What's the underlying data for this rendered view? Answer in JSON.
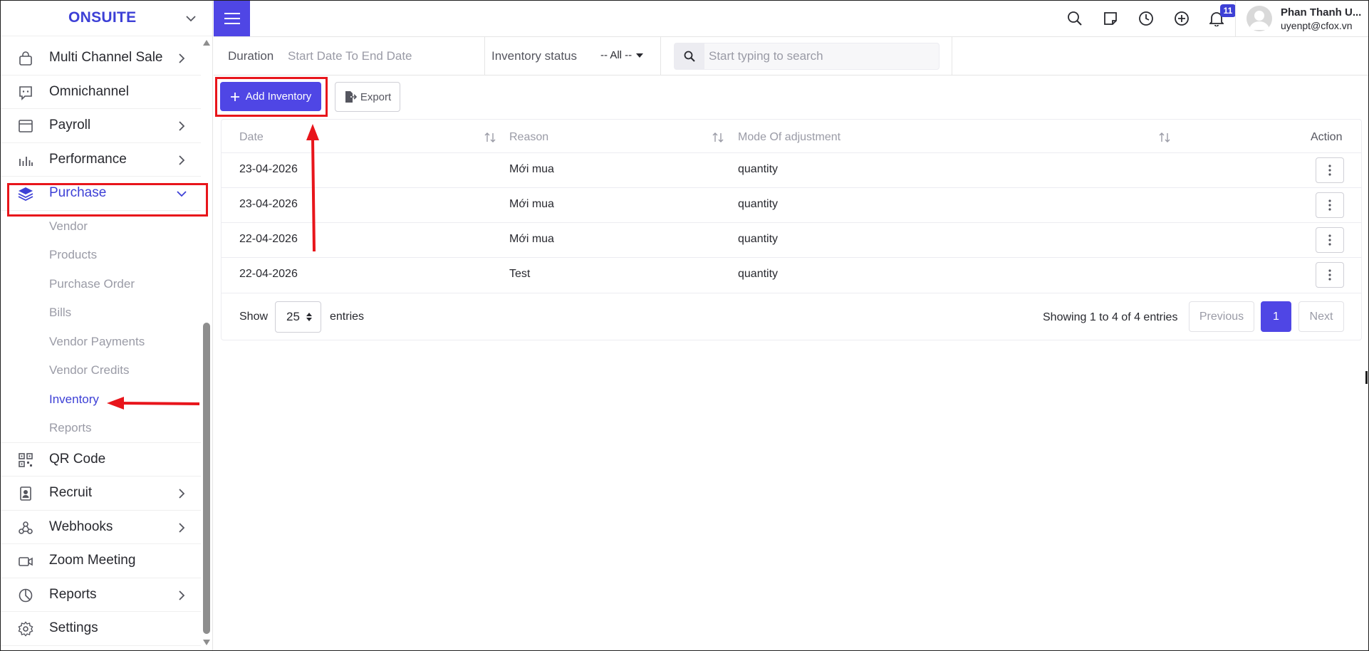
{
  "brand": {
    "name": "ONSUITE"
  },
  "sidebar": {
    "items": [
      {
        "label": "Multi Channel Sale",
        "icon": "shopping-bag-icon",
        "has_children": true
      },
      {
        "label": "Omnichannel",
        "icon": "chat-bubble-icon",
        "has_children": false
      },
      {
        "label": "Payroll",
        "icon": "calendar-window-icon",
        "has_children": true
      },
      {
        "label": "Performance",
        "icon": "bar-chart-icon",
        "has_children": true
      },
      {
        "label": "Purchase",
        "icon": "layers-icon",
        "has_children": true,
        "expanded": true
      }
    ],
    "purchase_sub": [
      "Vendor",
      "Products",
      "Purchase Order",
      "Bills",
      "Vendor Payments",
      "Vendor Credits",
      "Inventory",
      "Reports"
    ],
    "items_after": [
      {
        "label": "QR Code",
        "icon": "qr-code-icon",
        "has_children": false
      },
      {
        "label": "Recruit",
        "icon": "id-badge-icon",
        "has_children": true
      },
      {
        "label": "Webhooks",
        "icon": "webhook-icon",
        "has_children": true
      },
      {
        "label": "Zoom Meeting",
        "icon": "video-camera-icon",
        "has_children": false
      },
      {
        "label": "Reports",
        "icon": "pie-chart-icon",
        "has_children": true
      },
      {
        "label": "Settings",
        "icon": "gear-icon",
        "has_children": false
      }
    ]
  },
  "topbar": {
    "notification_count": "11",
    "user_name": "Phan Thanh U...",
    "user_email": "uyenpt@cfox.vn"
  },
  "filters": {
    "duration_label": "Duration",
    "date_placeholder": "Start Date To End Date",
    "status_label": "Inventory status",
    "status_value": "-- All --",
    "search_placeholder": "Start typing to search"
  },
  "actions": {
    "add_label": "Add Inventory",
    "export_label": "Export"
  },
  "table": {
    "columns": [
      "Date",
      "Reason",
      "Mode Of adjustment",
      "Action"
    ],
    "rows": [
      {
        "date": "23-04-2026",
        "reason": "Mới mua",
        "mode": "quantity"
      },
      {
        "date": "23-04-2026",
        "reason": "Mới mua",
        "mode": "quantity"
      },
      {
        "date": "22-04-2026",
        "reason": "Mới mua",
        "mode": "quantity"
      },
      {
        "date": "22-04-2026",
        "reason": "Test",
        "mode": "quantity"
      }
    ],
    "show_label": "Show",
    "page_size": "25",
    "entries_label": "entries",
    "showing_text": "Showing 1 to 4 of 4 entries",
    "pagination": {
      "previous": "Previous",
      "current": "1",
      "next": "Next"
    }
  },
  "colors": {
    "accent": "#4f46e5",
    "brand": "#3d40d6",
    "annotation": "#e8151b"
  }
}
